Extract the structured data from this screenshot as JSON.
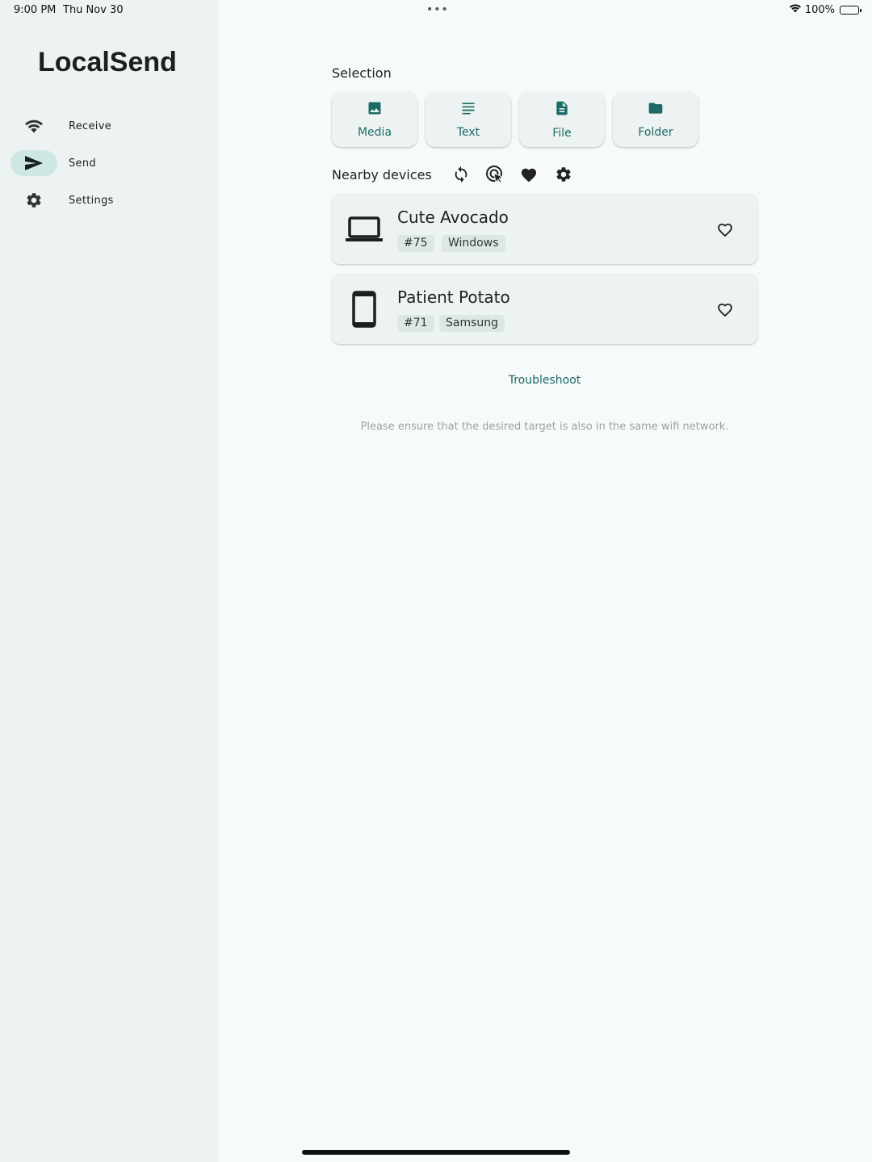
{
  "status_bar": {
    "time": "9:00 PM",
    "date": "Thu Nov 30",
    "dots": "•••",
    "battery": "100%"
  },
  "sidebar": {
    "app_title": "LocalSend",
    "items": [
      {
        "label": "Receive",
        "icon": "wifi-icon",
        "active": false
      },
      {
        "label": "Send",
        "icon": "send-icon",
        "active": true
      },
      {
        "label": "Settings",
        "icon": "gear-icon",
        "active": false
      }
    ]
  },
  "selection": {
    "title": "Selection",
    "buttons": [
      {
        "label": "Media",
        "icon": "image-icon"
      },
      {
        "label": "Text",
        "icon": "text-lines-icon"
      },
      {
        "label": "File",
        "icon": "file-icon"
      },
      {
        "label": "Folder",
        "icon": "folder-icon"
      }
    ]
  },
  "nearby": {
    "title": "Nearby devices",
    "tools": [
      "refresh-icon",
      "scan-target-icon",
      "heart-icon",
      "gear-icon"
    ]
  },
  "devices": [
    {
      "name": "Cute Avocado",
      "id": "#75",
      "platform": "Windows",
      "icon": "laptop-icon"
    },
    {
      "name": "Patient Potato",
      "id": "#71",
      "platform": "Samsung",
      "icon": "phone-icon"
    }
  ],
  "troubleshoot_label": "Troubleshoot",
  "hint": "Please ensure that the desired target is also in the same wifi network.",
  "colors": {
    "accent": "#1b6b64",
    "sidebar_bg": "#edf3f2",
    "page_bg": "#f7fafa",
    "nav_active_bg": "#cfe7e3"
  }
}
